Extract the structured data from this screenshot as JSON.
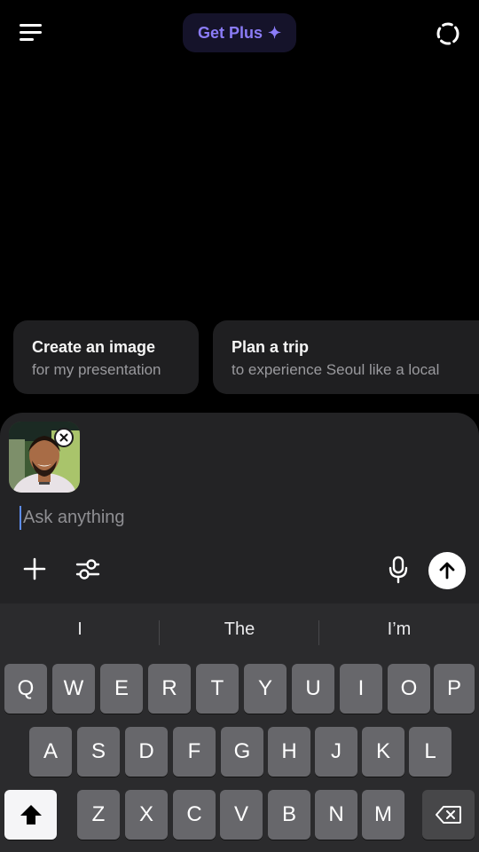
{
  "header": {
    "menu_icon": "menu-icon",
    "get_plus_label": "Get Plus",
    "sparkle_glyph": "✦",
    "temporary_chat_icon": "temporary-chat-icon"
  },
  "suggestions": [
    {
      "title": "Create an image",
      "subtitle": "for my presentation"
    },
    {
      "title": "Plan a trip",
      "subtitle": "to experience Seoul like a local"
    }
  ],
  "composer": {
    "attachment": {
      "type": "photo",
      "remove_icon": "close-icon"
    },
    "placeholder": "Ask anything",
    "value": ""
  },
  "keyboard": {
    "suggestions": [
      "I",
      "The",
      "I’m"
    ],
    "row1": [
      "Q",
      "W",
      "E",
      "R",
      "T",
      "Y",
      "U",
      "I",
      "O",
      "P"
    ],
    "row2": [
      "A",
      "S",
      "D",
      "F",
      "G",
      "H",
      "J",
      "K",
      "L"
    ],
    "row3": [
      "Z",
      "X",
      "C",
      "V",
      "B",
      "N",
      "M"
    ]
  },
  "colors": {
    "background": "#000000",
    "accent": "#8b7cf7",
    "composer": "#232325",
    "keyboard": "#2b2b2d"
  }
}
